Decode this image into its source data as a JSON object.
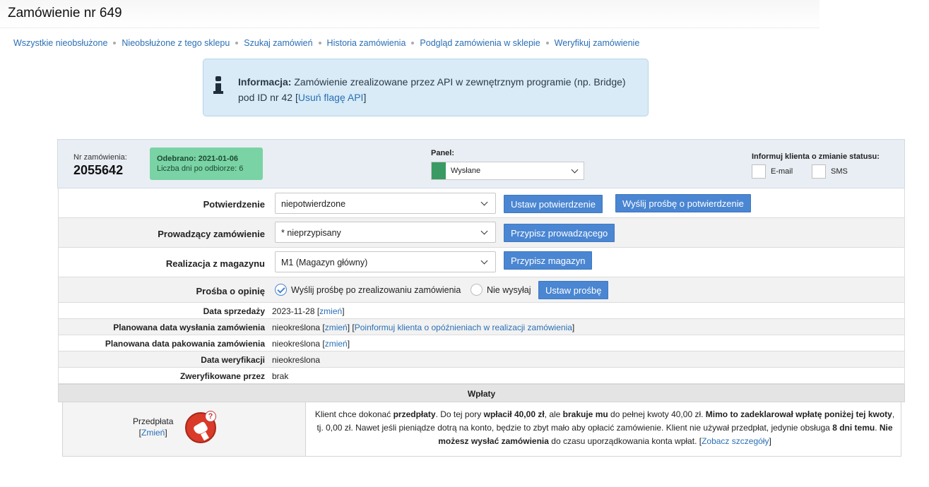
{
  "page": {
    "title": "Zamówienie nr 649"
  },
  "nav": {
    "items": [
      "Wszystkie nieobsłużone",
      "Nieobsłużone z tego sklepu",
      "Szukaj zamówień",
      "Historia zamówienia",
      "Podgląd zamówienia w sklepie",
      "Weryfikuj zamówienie"
    ]
  },
  "info": {
    "label": "Informacja:",
    "text_before": " Zamówienie zrealizowane przez API w zewnętrznym programie (np. Bridge) pod ID nr 42 [",
    "link": "Usuń flagę API",
    "text_after": "]"
  },
  "order_header": {
    "nr_label": "Nr zamówienia:",
    "nr_value": "2055642",
    "badge_line1": "Odebrano: 2021-01-06",
    "badge_line2": "Liczba dni po odbiorze: 6",
    "panel_label": "Panel:",
    "panel_value": "Wysłane",
    "panel_color": "#3a9a63",
    "inform_label": "Informuj klienta o zmianie statusu:",
    "email_label": "E-mail",
    "sms_label": "SMS"
  },
  "rows": {
    "potwierdzenie": {
      "label": "Potwierdzenie",
      "select": "niepotwierdzone",
      "btn1": "Ustaw potwierdzenie",
      "btn2": "Wyślij prośbę o potwierdzenie"
    },
    "prowadzacy": {
      "label": "Prowadzący zamówienie",
      "select": "* nieprzypisany",
      "btn": "Przypisz prowadzącego"
    },
    "magazyn": {
      "label": "Realizacja z magazynu",
      "select": "M1 (Magazyn główny)",
      "btn": "Przypisz magazyn"
    },
    "opinia": {
      "label": "Prośba o opinię",
      "radio1": "Wyślij prośbę po zrealizowaniu zamówienia",
      "radio2": "Nie wysyłaj",
      "btn": "Ustaw prośbę"
    },
    "data_sprzedazy": {
      "label": "Data sprzedaży",
      "value": "2023-11-28",
      "link": "zmień"
    },
    "data_wysylki": {
      "label": "Planowana data wysłania zamówienia",
      "value": "nieokreślona",
      "link": "zmień",
      "link2": "Poinformuj klienta o opóźnieniach w realizacji zamówienia"
    },
    "data_pakowania": {
      "label": "Planowana data pakowania zamówienia",
      "value": "nieokreślona",
      "link": "zmień"
    },
    "data_weryfikacji": {
      "label": "Data weryfikacji",
      "value": "nieokreślona"
    },
    "zweryfikowane": {
      "label": "Zweryfikowane przez",
      "value": "brak"
    }
  },
  "payments": {
    "title": "Wpłaty",
    "type_label": "Przedpłata",
    "change_link": "Zmień",
    "t1": "Klient chce dokonać ",
    "b1": "przedpłaty",
    "t2": ". Do tej pory ",
    "b2": "wpłacił 40,00 zł",
    "t3": ", ale ",
    "b3": "brakuje mu",
    "t4": " do pełnej kwoty 40,00 zł. ",
    "b4": "Mimo to zadeklarował wpłatę poniżej tej kwoty",
    "t5": ", tj. 0,00 zł. Nawet jeśli pieniądze dotrą na konto, będzie to zbyt mało aby opłacić zamówienie. Klient nie używał przedpłat, jedynie obsługa ",
    "b5": "8 dni temu",
    "t6": ". ",
    "b6": "Nie możesz wysłać zamówienia",
    "t7": " do czasu uporządkowania konta wpłat. [",
    "link": "Zobacz szczegóły",
    "t8": "]"
  }
}
